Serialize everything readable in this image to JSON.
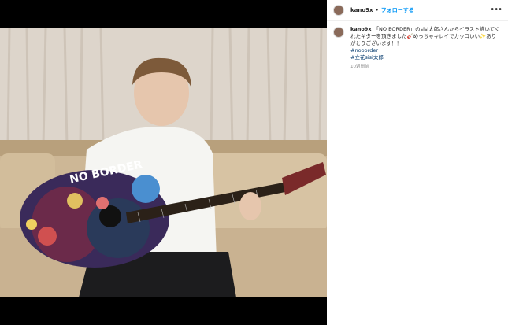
{
  "post": {
    "username": "kano9x",
    "separator": "•",
    "follow_label": "フォローする",
    "more_icon": "more-icon",
    "caption": "「NO BORDER」のsisi太郎さんからイラスト描いてくれたギターを頂きました🎸めっちゃキレイでカッコいい✨ありがとうございます！！",
    "hashtags": [
      "#noborder",
      "#立花sisi太郎"
    ],
    "timestamp": "10週間前"
  },
  "photo": {
    "guitar_text": "NO BORDER"
  },
  "colors": {
    "link_blue": "#0095f6",
    "hashtag_blue": "#00376b",
    "text": "#262626",
    "muted": "#8e8e8e"
  }
}
